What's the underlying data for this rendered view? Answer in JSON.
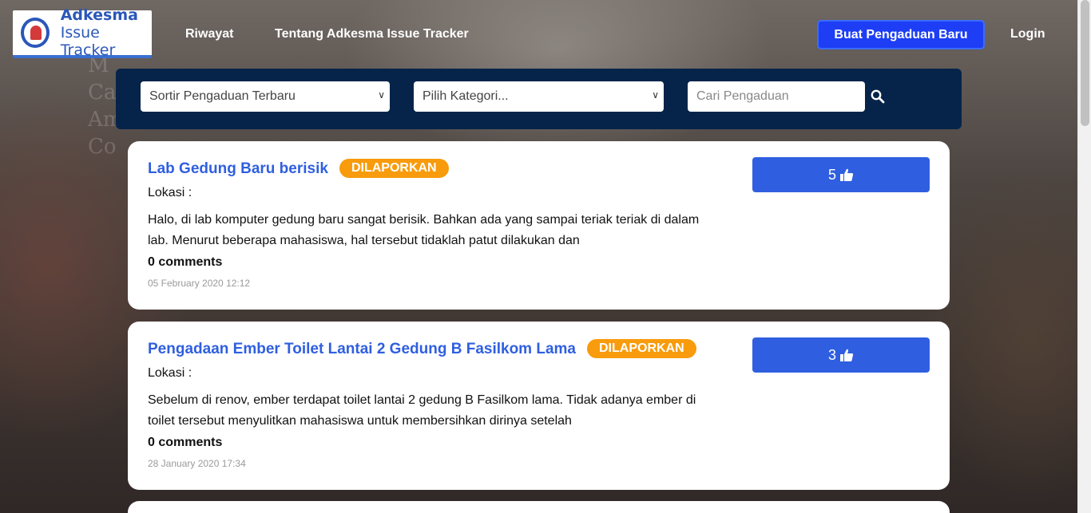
{
  "brand": {
    "line1": "Adkesma",
    "line2": "Issue Tracker",
    "color": "#2b57b8"
  },
  "nav": {
    "history": "Riwayat",
    "about": "Tentang Adkesma Issue Tracker",
    "new_complaint": "Buat Pengaduan Baru",
    "login": "Login"
  },
  "filters": {
    "sort_selected": "Sortir Pengaduan Terbaru",
    "category_selected": "Pilih Kategori...",
    "search_placeholder": "Cari Pengaduan"
  },
  "background_text": [
    "M",
    "Cappuccin",
    "Am",
    "Co"
  ],
  "complaints": [
    {
      "title": "Lab Gedung Baru berisik",
      "status": "DILAPORKAN",
      "location_label": "Lokasi :",
      "body": "Halo, di lab komputer gedung baru sangat berisik. Bahkan ada yang sampai teriak teriak di dalam lab. Menurut beberapa mahasiswa, hal tersebut tidaklah patut dilakukan dan",
      "comments": "0 comments",
      "date": "05 February 2020 12:12",
      "votes": "5"
    },
    {
      "title": "Pengadaan Ember Toilet Lantai 2 Gedung B Fasilkom Lama",
      "status": "DILAPORKAN",
      "location_label": "Lokasi :",
      "body": "Sebelum di renov, ember terdapat toilet lantai 2 gedung B Fasilkom lama. Tidak adanya ember di toilet tersebut menyulitkan mahasiswa untuk membersihkan dirinya setelah",
      "comments": "0 comments",
      "date": "28 January 2020 17:34",
      "votes": "3"
    }
  ],
  "colors": {
    "accent": "#1d3ef5",
    "title": "#2f5fe0",
    "badge": "#f89b0c",
    "filter_bar": "#06244a"
  }
}
